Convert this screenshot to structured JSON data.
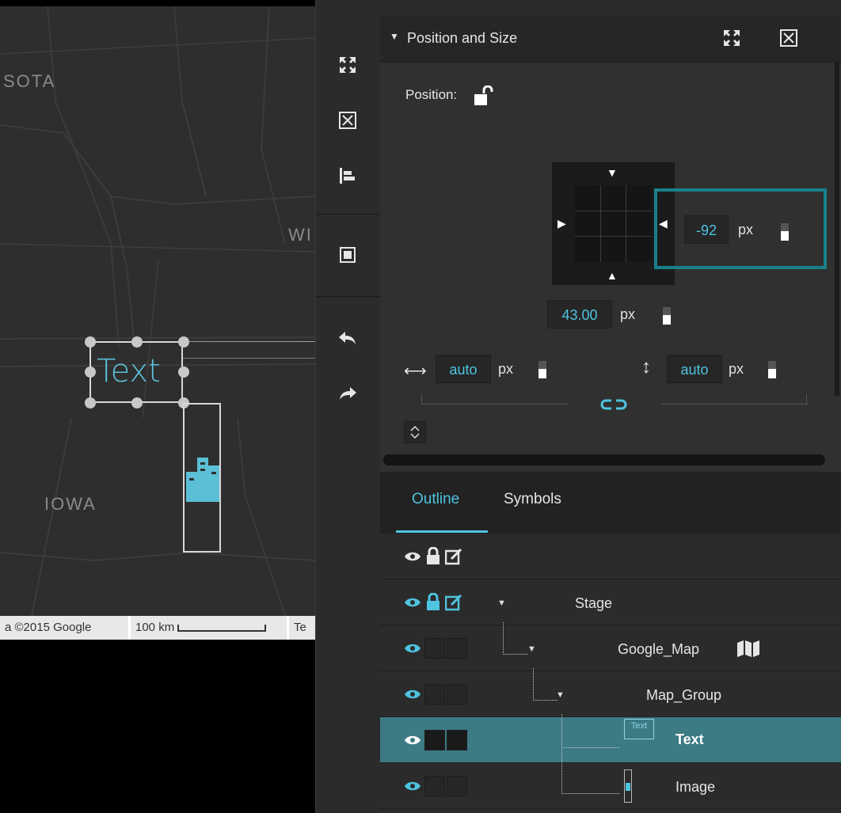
{
  "map": {
    "labels": {
      "minnesota": "SOTA",
      "wisconsin": "WI",
      "iowa": "IOWA"
    },
    "footer": {
      "copyright": "a ©2015 Google",
      "scale": "100 km",
      "terms": "Te"
    },
    "text_element": "Text"
  },
  "panel": {
    "section": {
      "title": "Position and Size",
      "collapse_glyph": "▼"
    },
    "position_label": "Position:",
    "right_offset": {
      "value": "-92",
      "unit": "px"
    },
    "bottom_offset": {
      "value": "43.00",
      "unit": "px"
    },
    "width": {
      "value": "auto",
      "unit": "px"
    },
    "height": {
      "value": "auto",
      "unit": "px"
    }
  },
  "outline": {
    "tabs": [
      {
        "label": "Outline",
        "active": true
      },
      {
        "label": "Symbols",
        "active": false
      }
    ],
    "rows": [
      {
        "name": "",
        "kind": "header"
      },
      {
        "name": "Stage"
      },
      {
        "name": "Google_Map"
      },
      {
        "name": "Map_Group"
      },
      {
        "name": "Text",
        "selected": true,
        "thumb": "Text"
      },
      {
        "name": "Image"
      }
    ]
  },
  "colors": {
    "accent": "#4ec4e0",
    "highlight_border": "#18808a",
    "selected_row": "#3c7a84",
    "panel_bg": "#303030"
  },
  "icons": {
    "toolbar": [
      "fit-expand-icon",
      "fit-contain-icon",
      "align-left-icon",
      "center-icon",
      "undo-icon",
      "redo-icon"
    ],
    "section": [
      "fit-expand-icon",
      "fit-contain-icon"
    ]
  }
}
